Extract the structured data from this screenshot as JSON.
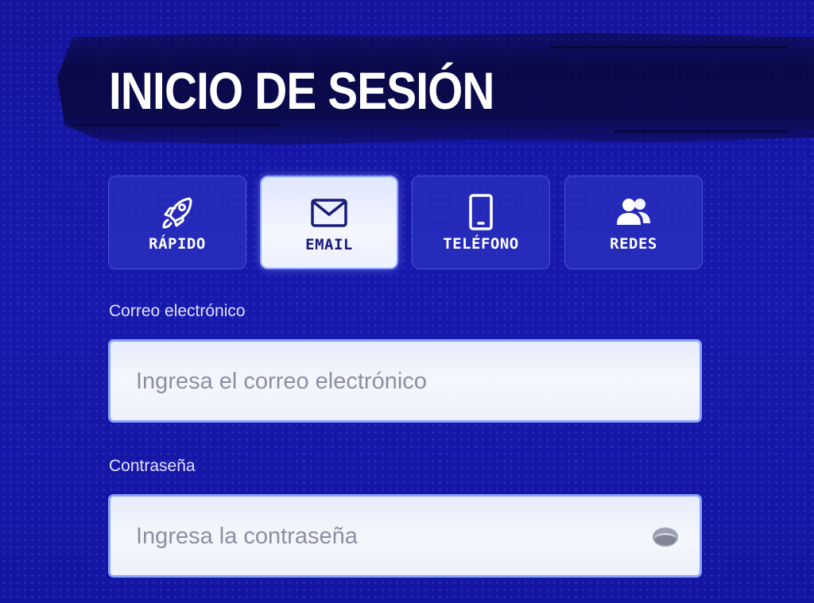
{
  "header": {
    "title": "INICIO DE SESIÓN"
  },
  "tabs": [
    {
      "label": "RÁPIDO",
      "icon": "rocket-icon",
      "active": false
    },
    {
      "label": "EMAIL",
      "icon": "envelope-icon",
      "active": true
    },
    {
      "label": "TELÉFONO",
      "icon": "phone-icon",
      "active": false
    },
    {
      "label": "REDES",
      "icon": "users-icon",
      "active": false
    }
  ],
  "form": {
    "email": {
      "label": "Correo electrónico",
      "value": "",
      "placeholder": "Ingresa el correo electrónico"
    },
    "password": {
      "label": "Contraseña",
      "value": "",
      "placeholder": "Ingresa la contraseña",
      "toggle_icon": "eye-icon"
    }
  },
  "colors": {
    "background": "#1616a8",
    "banner": "#08083c",
    "tab_inactive": "#2a30be",
    "tab_active": "#eef1ff",
    "input_border": "#8aa2ff",
    "label_text": "#dfe3ff"
  }
}
